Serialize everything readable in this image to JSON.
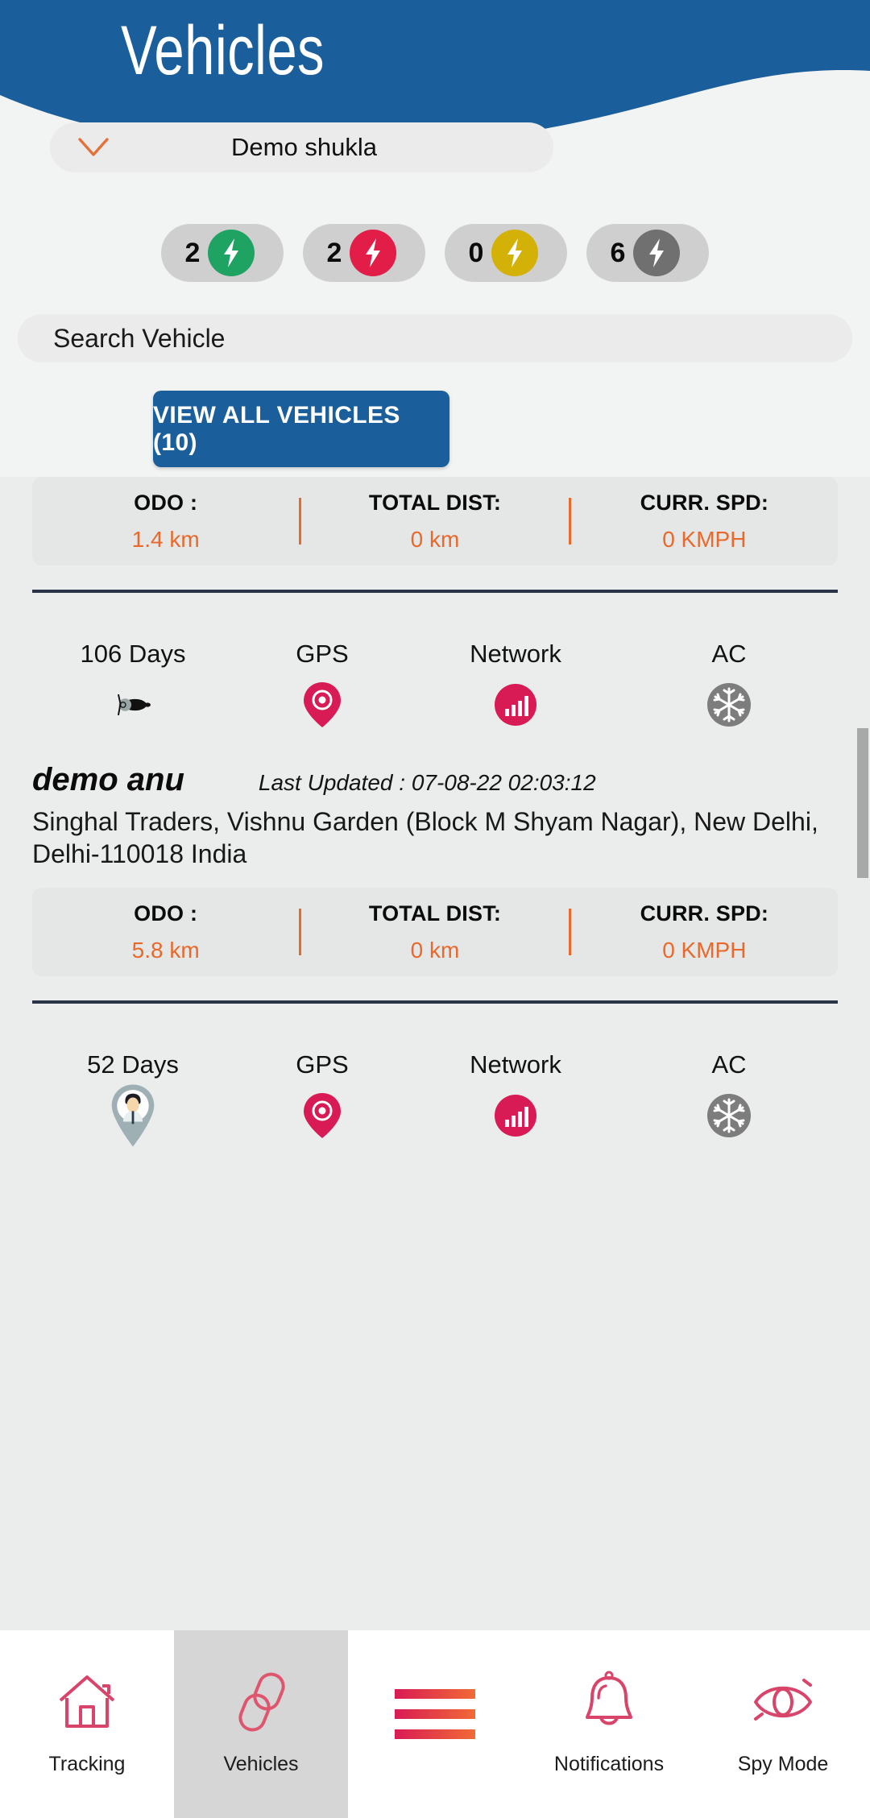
{
  "header": {
    "title": "Vehicles",
    "brand_color": "#1a5e9c"
  },
  "account": {
    "name": "Demo shukla",
    "chevron_icon": "chevron-down-icon",
    "chevron_color": "#e3713a"
  },
  "status_pills": [
    {
      "count": "2",
      "color": "#1ea362",
      "icon": "bolt-icon",
      "state": "running"
    },
    {
      "count": "2",
      "color": "#e11d48",
      "icon": "bolt-icon",
      "state": "stopped"
    },
    {
      "count": "0",
      "color": "#d4b106",
      "icon": "bolt-icon",
      "state": "idle"
    },
    {
      "count": "6",
      "color": "#707070",
      "icon": "bolt-icon",
      "state": "offline"
    }
  ],
  "search": {
    "placeholder": "Search Vehicle",
    "value": ""
  },
  "view_all_button": {
    "label": "VIEW ALL VEHICLES (10)"
  },
  "stat_labels": {
    "odo": "ODO :",
    "total_dist": "TOTAL DIST:",
    "curr_spd": "CURR. SPD:"
  },
  "status_labels": {
    "gps": "GPS",
    "network": "Network",
    "ac": "AC"
  },
  "last_updated_label": "Last Updated :",
  "accent_colors": {
    "orange": "#e8692b",
    "pink": "#d81b54",
    "gray": "#7d7d7d"
  },
  "vehicles": [
    {
      "odo": "1.4 km",
      "total_dist": "0 km",
      "curr_spd": "0 KMPH",
      "days": "106 Days",
      "vehicle_icon": "scooter-icon",
      "gps_icon": "location-pin-icon",
      "network_icon": "signal-bars-icon",
      "ac_icon": "snowflake-icon"
    },
    {
      "name": "demo anu",
      "last_updated": "07-08-22 02:03:12",
      "address": "Singhal Traders, Vishnu Garden (Block M Shyam Nagar), New Delhi, Delhi-110018 India",
      "odo": "5.8 km",
      "total_dist": "0 km",
      "curr_spd": "0 KMPH",
      "days": "52 Days",
      "vehicle_icon": "person-pin-icon",
      "gps_icon": "location-pin-icon",
      "network_icon": "signal-bars-icon",
      "ac_icon": "snowflake-icon"
    }
  ],
  "bottom_nav": [
    {
      "label": "Tracking",
      "icon": "home-icon",
      "active": false
    },
    {
      "label": "Vehicles",
      "icon": "link-chain-icon",
      "active": true
    },
    {
      "label": "",
      "icon": "hamburger-menu-icon",
      "active": false
    },
    {
      "label": "Notifications",
      "icon": "bell-icon",
      "active": false
    },
    {
      "label": "Spy Mode",
      "icon": "eye-icon",
      "active": false
    }
  ]
}
